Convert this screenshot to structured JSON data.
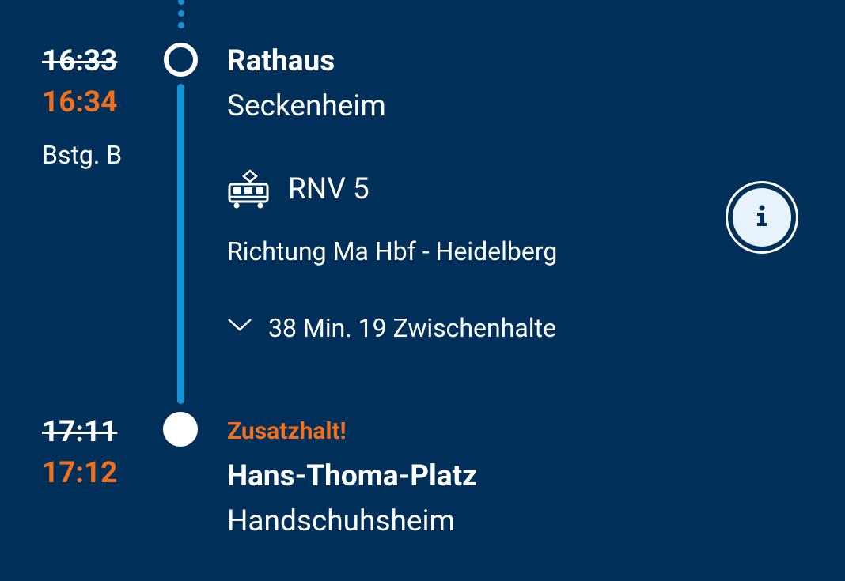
{
  "departure": {
    "time_scheduled": "16:33",
    "time_actual": "16:34",
    "platform": "Bstg. B",
    "stop_name": "Rathaus",
    "stop_area": "Seckenheim"
  },
  "leg": {
    "line": "RNV 5",
    "direction": "Richtung Ma Hbf - Heidelberg",
    "summary": "38 Min. 19 Zwischenhalte",
    "icon": "tram-icon"
  },
  "arrival": {
    "notice": "Zusatzhalt!",
    "time_scheduled": "17:11",
    "time_actual": "17:12",
    "stop_name": "Hans-Thoma-Platz",
    "stop_area": "Handschuhsheim"
  },
  "colors": {
    "background": "#00305a",
    "delay": "#f07020",
    "track": "#1593d6"
  }
}
